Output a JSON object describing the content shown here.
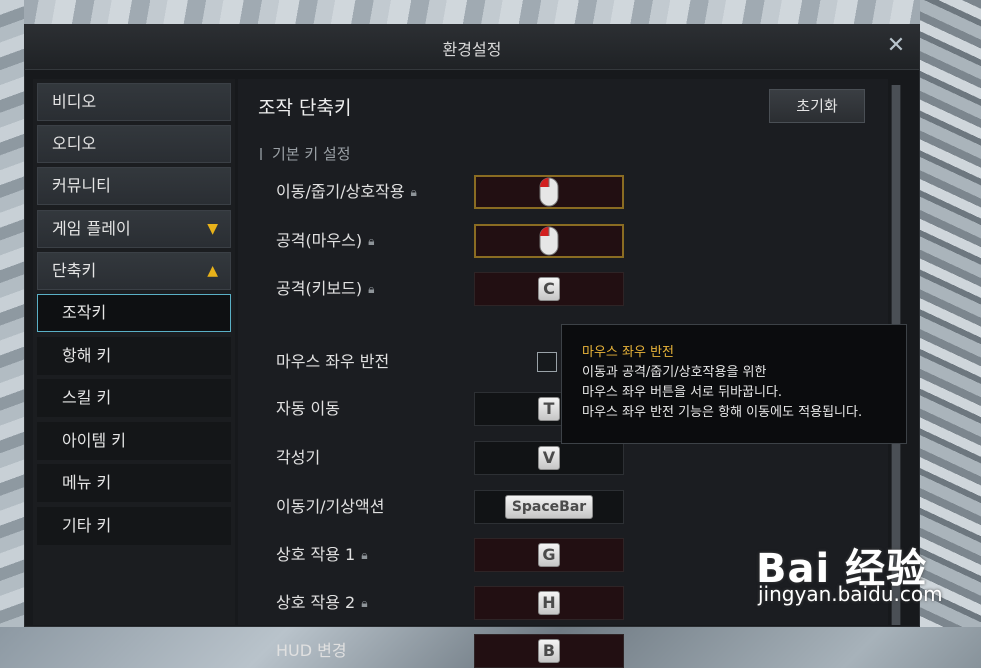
{
  "window": {
    "title": "환경설정"
  },
  "sidebar": {
    "categories": [
      {
        "label": "비디오"
      },
      {
        "label": "오디오"
      },
      {
        "label": "커뮤니티"
      },
      {
        "label": "게임 플레이"
      },
      {
        "label": "단축키"
      }
    ],
    "subitems": [
      {
        "label": "조작키"
      },
      {
        "label": "항해 키"
      },
      {
        "label": "스킬 키"
      },
      {
        "label": "아이템 키"
      },
      {
        "label": "메뉴 키"
      },
      {
        "label": "기타 키"
      }
    ],
    "active_subitem": "조작키"
  },
  "main": {
    "title": "조작 단축키",
    "reset_label": "초기화",
    "section_label": "기본 키 설정",
    "rows": [
      {
        "label": "이동/줍기/상호작용",
        "locked": true,
        "key": "mouse-left",
        "highlighted": true
      },
      {
        "label": "공격(마우스)",
        "locked": true,
        "key": "mouse-left",
        "highlighted": true
      },
      {
        "label": "공격(키보드)",
        "locked": true,
        "key": "C"
      },
      {
        "label": "마우스 좌우 반전",
        "locked": false,
        "control": "checkbox",
        "checked": false
      },
      {
        "label": "자동 이동",
        "locked": false,
        "key": "T"
      },
      {
        "label": "각성기",
        "locked": false,
        "key": "V"
      },
      {
        "label": "이동기/기상액션",
        "locked": false,
        "key": "SpaceBar"
      },
      {
        "label": "상호 작용 1",
        "locked": true,
        "key": "G"
      },
      {
        "label": "상호 작용 2",
        "locked": true,
        "key": "H"
      },
      {
        "label": "HUD 변경",
        "locked": false,
        "key": "B"
      }
    ]
  },
  "tooltip": {
    "title": "마우스 좌우 반전",
    "lines": [
      "이동과 공격/줍기/상호작용을 위한",
      "마우스 좌우 버튼을 서로 뒤바꿉니다.",
      "마우스 좌우 반전 기능은 항해 이동에도 적용됩니다."
    ]
  },
  "watermark": {
    "logo": "Bai 经验",
    "url": "jingyan.baidu.com"
  },
  "colors": {
    "accent_gold": "#e8b21a",
    "active_border": "#5ab0c6",
    "key_bg": "#220f12"
  }
}
